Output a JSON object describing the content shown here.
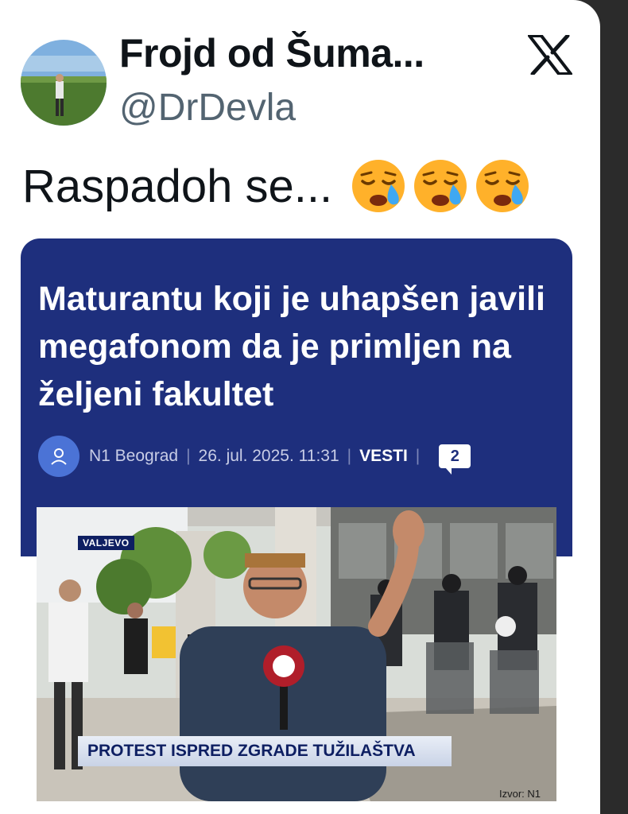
{
  "tweet": {
    "display_name": "Frojd od Šuma...",
    "handle": "@DrDevla",
    "text": "Raspadoh se...",
    "emoji_icons": [
      "crying-face-icon",
      "crying-face-icon",
      "crying-face-icon"
    ],
    "platform_icon": "x-logo-icon"
  },
  "article": {
    "headline": "Maturantu koji je uhapšen javili megafonom da je primljen na željeni fakultet",
    "author": "N1 Beograd",
    "date": "26. jul. 2025. 11:31",
    "section": "VESTI",
    "comment_count": "2",
    "colors": {
      "background": "#1e2f7d",
      "accent": "#4b73d6"
    }
  },
  "photo": {
    "location_tag": "VALJEVO",
    "lower_third": "PROTEST ISPRED ZGRADE TUŽILAŠTVA",
    "source": "Izvor: N1",
    "mic_logo": "n1-logo"
  }
}
